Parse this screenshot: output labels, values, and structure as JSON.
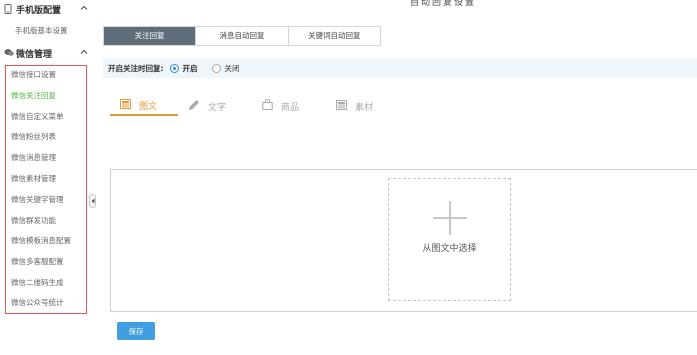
{
  "page_title": "自动回复设置",
  "sidebar": {
    "mobile_section": {
      "label": "手机版配置",
      "items": [
        {
          "label": "手机版基本设置"
        }
      ]
    },
    "wechat_section": {
      "label": "微信管理",
      "items": [
        {
          "label": "微信接口设置"
        },
        {
          "label": "微信关注回复",
          "active": true
        },
        {
          "label": "微信自定义菜单"
        },
        {
          "label": "微信粉丝列表"
        },
        {
          "label": "微信消息管理"
        },
        {
          "label": "微信素材管理"
        },
        {
          "label": "微信关键字管理"
        },
        {
          "label": "微信群发功能"
        },
        {
          "label": "微信模板消息配置"
        },
        {
          "label": "微信多客服配置"
        },
        {
          "label": "微信二维码生成"
        },
        {
          "label": "微信公众号统计"
        }
      ]
    }
  },
  "tabs": [
    {
      "label": "关注回复",
      "active": true
    },
    {
      "label": "消息自动回复"
    },
    {
      "label": "关键词自动回复"
    }
  ],
  "follow_reply": {
    "label": "开启关注时回复:",
    "options": [
      {
        "label": "开启",
        "checked": true
      },
      {
        "label": "关闭"
      }
    ]
  },
  "content_types": [
    {
      "label": "图文",
      "icon": "image-text-icon",
      "active": true
    },
    {
      "label": "文字",
      "icon": "pen-icon"
    },
    {
      "label": "商品",
      "icon": "bag-icon"
    },
    {
      "label": "素材",
      "icon": "material-icon"
    }
  ],
  "picker": {
    "label": "从图文中选择"
  },
  "save_label": "保存",
  "colors": {
    "accent_green": "#56b24a",
    "tab_active": "#5f6d7b",
    "orange": "#e69a3a",
    "blue": "#3f9de0",
    "highlight_box": "#e05a5a"
  }
}
